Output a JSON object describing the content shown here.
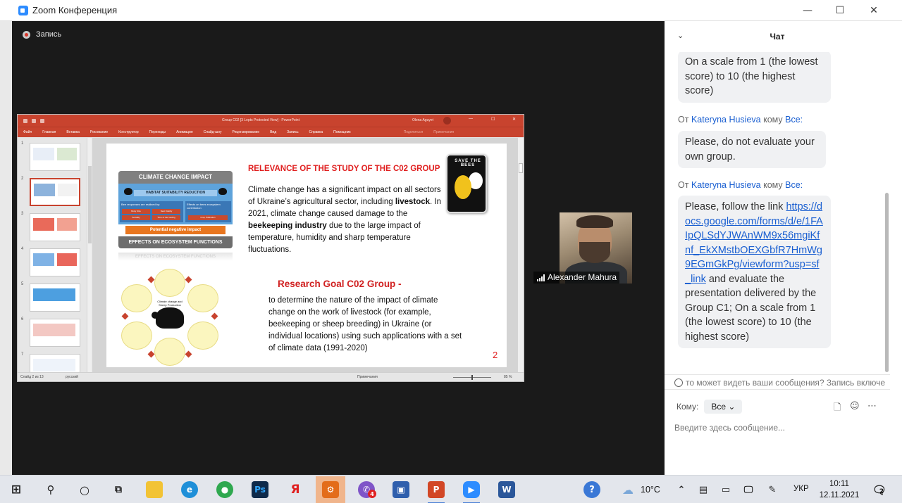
{
  "window": {
    "title": "Zoom Конференция",
    "controls": {
      "minimize": "—",
      "maximize": "☐",
      "close": "✕"
    }
  },
  "recording": {
    "label": "Запись"
  },
  "powerpoint": {
    "doc_title": "Group C02 [3 Lepts Protected View] - PowerPoint",
    "user": "Olena Aguyet",
    "tabs": [
      "Файл",
      "Главная",
      "Вставка",
      "Рисование",
      "Конструктор",
      "Переходы",
      "Анимация",
      "Слайд-шоу",
      "Рецензирование",
      "Вид",
      "Запись",
      "Справка",
      "Помощник"
    ],
    "faded_tabs": [
      "Поделиться",
      "Примечания"
    ],
    "status": {
      "slide": "Слайд 2 из 13",
      "lang": "русский",
      "notes": "Примечания",
      "zoom": "85 %"
    },
    "thumbnails": [
      "1",
      "2",
      "3",
      "4",
      "5",
      "6",
      "7"
    ]
  },
  "slide": {
    "diagram": {
      "head": "CLIMATE CHANGE IMPACT",
      "habitat": "HABITAT SUITABILITY REDUCTION",
      "left_sub": "Bee responses are realised by:",
      "right_sub": "Effects on bees ecosystem contribution",
      "left_cells": [
        "Body Size",
        "Nest Fidelity",
        "Sociality",
        "Time of the nesting",
        "Crop Pollination"
      ],
      "orange": "Potential negative impact",
      "foot": "EFFECTS ON ECOSYSTEM FUNCTIONS",
      "ghost": "EFFECTS ON ECOSYSTEM FUNCTIONS",
      "center": "Climate change and Sheep Production"
    },
    "sticker": "SAVE THE BEES",
    "relevance_title": "RELEVANCE OF THE STUDY OF THE C02 GROUP",
    "relevance_parts": [
      "Climate change has a significant impact on all sectors of Ukraine’s agricultural sector, including ",
      "livestock",
      ". In 2021, climate change caused damage to the ",
      "beekeeping industry",
      " due to the large impact of temperature, humidity and sharp temperature fluctuations."
    ],
    "goal_title": "Research Goal C02 Group -",
    "goal_text": "to determine the nature of the impact of climate change on the work of livestock (for example, beekeeping or sheep breeding) in Ukraine (or individual locations) using such applications with a set of climate data (1991-2020)",
    "number": "2"
  },
  "participant": {
    "name": "Alexander Mahura"
  },
  "chat": {
    "title": "Чат",
    "messages": [
      {
        "text": "On a scale from 1 (the lowest score) to 10 (the highest score)"
      },
      {
        "from_prefix": "От",
        "from": "Kateryna Husieva",
        "to_prefix": "кому",
        "to": "Все:",
        "text": "Please, do not evaluate your own group."
      },
      {
        "from_prefix": "От",
        "from": "Kateryna Husieva",
        "to_prefix": "кому",
        "to": "Все:",
        "text_before": "Please, follow the link",
        "link": "https://docs.google.com/forms/d/e/1FAIpQLSdYJWAnWM9x56mgiKfnf_EkXMstbOEXGbfR7HmWg9EGmGkPg/viewform?usp=sf_link",
        "text_after": "and evaluate the presentation delivered by the Group C1; On a scale from 1 (the lowest score) to 10 (the highest score)"
      }
    ],
    "notice": "то может видеть ваши сообщения? Запись включе",
    "to_label": "Кому:",
    "to_value": "Все",
    "input_placeholder": "Введите здесь сообщение..."
  },
  "taskbar": {
    "weather": "10°C",
    "lang": "УКР",
    "time": "10:11",
    "date": "12.11.2021",
    "notifications": "2",
    "badge": "4"
  }
}
